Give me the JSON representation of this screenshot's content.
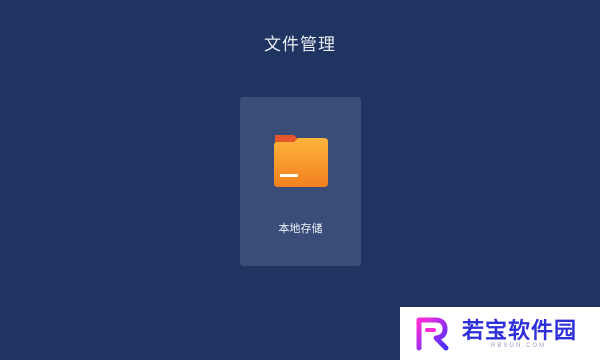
{
  "header": {
    "title": "文件管理"
  },
  "storage": {
    "label": "本地存储",
    "icon": "folder-icon"
  },
  "watermark": {
    "text": "若宝软件园",
    "url": "RBSGN.COM",
    "logo": "rb-logo"
  },
  "colors": {
    "background": "#1f3461",
    "card": "#3a4d78",
    "folder_front": "#f68d2a",
    "folder_tab": "#e5562b",
    "watermark_text": "#2e2fd9"
  }
}
